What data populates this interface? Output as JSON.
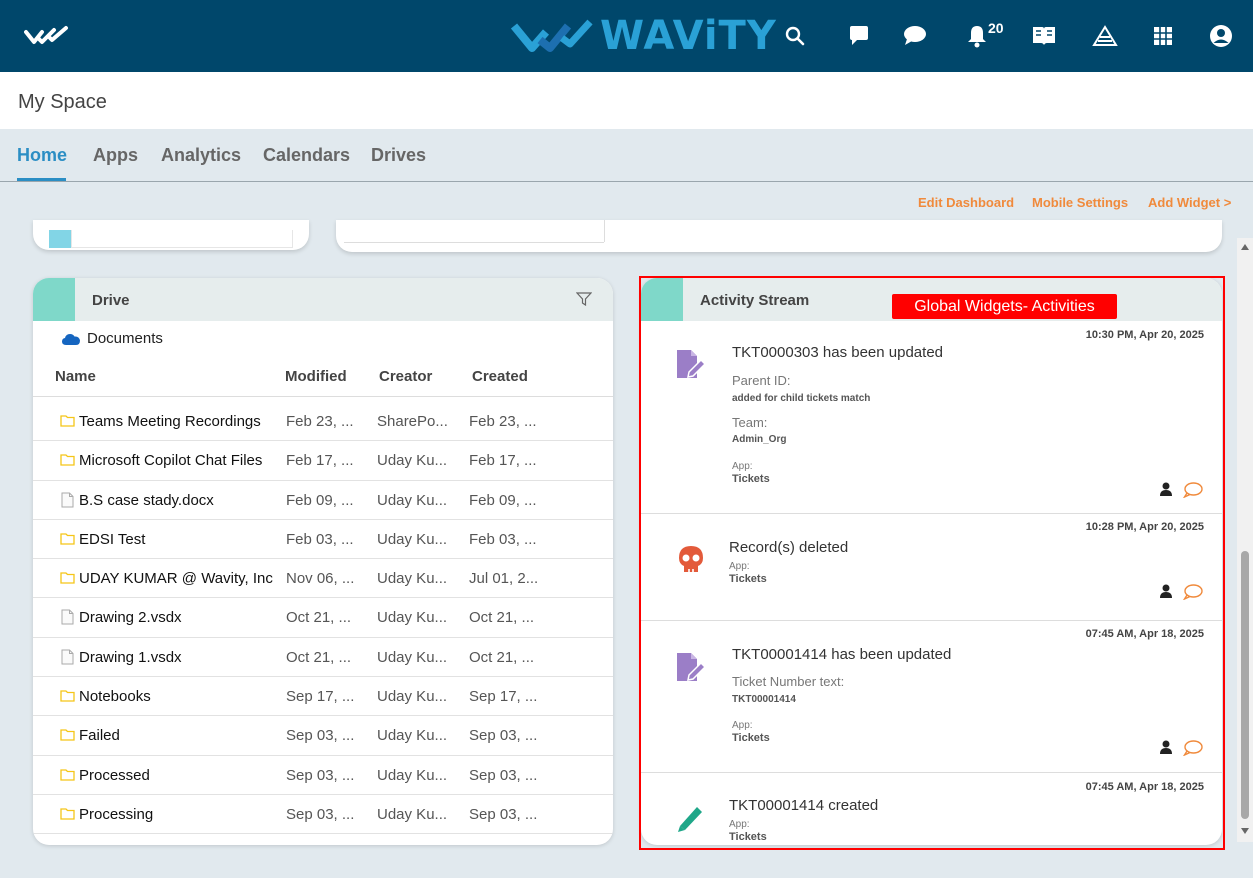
{
  "brand": {
    "name": "WAViTY",
    "mark_color": "#2aa1d6",
    "bar_color": "#00476b"
  },
  "navbar": {
    "icons": [
      "search-icon",
      "chat-icon",
      "messages-icon",
      "bell-icon",
      "book-icon",
      "cone-icon",
      "grid-icon",
      "user-icon"
    ],
    "notification_count": "20"
  },
  "space": {
    "title": "My Space"
  },
  "tabs": [
    {
      "label": "Home",
      "active": true
    },
    {
      "label": "Apps"
    },
    {
      "label": "Analytics"
    },
    {
      "label": "Calendars"
    },
    {
      "label": "Drives"
    }
  ],
  "actions": {
    "edit": "Edit Dashboard",
    "mobile": "Mobile Settings",
    "add": "Add Widget >"
  },
  "drive": {
    "title": "Drive",
    "source": "Documents",
    "columns": {
      "name": "Name",
      "modified": "Modified",
      "creator": "Creator",
      "created": "Created"
    },
    "rows": [
      {
        "type": "folder",
        "name": "Teams Meeting Recordings",
        "modified": "Feb 23, ...",
        "creator": "SharePo...",
        "created": "Feb 23, ..."
      },
      {
        "type": "folder",
        "name": "Microsoft Copilot Chat Files",
        "modified": "Feb 17, ...",
        "creator": "Uday Ku...",
        "created": "Feb 17, ..."
      },
      {
        "type": "file",
        "name": "B.S case stady.docx",
        "modified": "Feb 09, ...",
        "creator": "Uday Ku...",
        "created": "Feb 09, ..."
      },
      {
        "type": "folder",
        "name": "EDSI Test",
        "modified": "Feb 03, ...",
        "creator": "Uday Ku...",
        "created": "Feb 03, ..."
      },
      {
        "type": "folder",
        "name": "UDAY KUMAR @ Wavity, Inc",
        "modified": "Nov 06, ...",
        "creator": "Uday Ku...",
        "created": "Jul 01, 2..."
      },
      {
        "type": "file",
        "name": "Drawing 2.vsdx",
        "modified": "Oct 21, ...",
        "creator": "Uday Ku...",
        "created": "Oct 21, ..."
      },
      {
        "type": "file",
        "name": "Drawing 1.vsdx",
        "modified": "Oct 21, ...",
        "creator": "Uday Ku...",
        "created": "Oct 21, ..."
      },
      {
        "type": "folder",
        "name": "Notebooks",
        "modified": "Sep 17, ...",
        "creator": "Uday Ku...",
        "created": "Sep 17, ..."
      },
      {
        "type": "folder",
        "name": "Failed",
        "modified": "Sep 03, ...",
        "creator": "Uday Ku...",
        "created": "Sep 03, ..."
      },
      {
        "type": "folder",
        "name": "Processed",
        "modified": "Sep 03, ...",
        "creator": "Uday Ku...",
        "created": "Sep 03, ..."
      },
      {
        "type": "folder",
        "name": "Processing",
        "modified": "Sep 03, ...",
        "creator": "Uday Ku...",
        "created": "Sep 03, ..."
      }
    ]
  },
  "activity": {
    "title": "Activity Stream",
    "annotation": "Global Widgets- Activities",
    "items": [
      {
        "time": "10:30 PM, Apr 20, 2025",
        "title": "TKT0000303 has been updated",
        "icon": "edit-document-icon",
        "field1_label": "Parent ID:",
        "field1_value": "added for child tickets match",
        "field2_label": "Team:",
        "field2_value": "Admin_Org",
        "app_label": "App:",
        "app_value": "Tickets"
      },
      {
        "time": "10:28 PM, Apr 20, 2025",
        "title": "Record(s) deleted",
        "icon": "skull-icon",
        "app_label": "App:",
        "app_value": "Tickets"
      },
      {
        "time": "07:45 AM, Apr 18, 2025",
        "title": "TKT00001414 has been updated",
        "icon": "edit-document-icon",
        "field1_label": "Ticket Number text:",
        "field1_value": "TKT00001414",
        "app_label": "App:",
        "app_value": "Tickets"
      },
      {
        "time": "07:45 AM, Apr 18, 2025",
        "title": "TKT00001414 created",
        "icon": "pencil-icon",
        "app_label": "App:",
        "app_value": "Tickets"
      }
    ]
  }
}
